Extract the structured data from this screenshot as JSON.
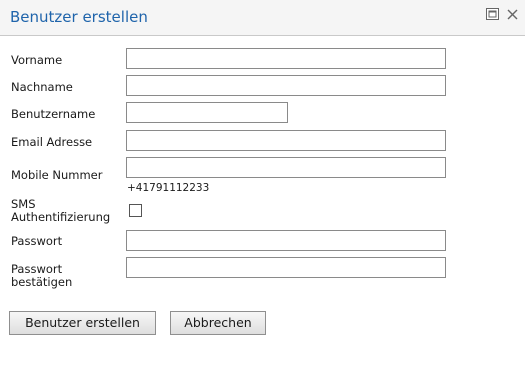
{
  "dialog": {
    "title": "Benutzer erstellen"
  },
  "window_controls": {
    "maximize_icon": "maximize-icon",
    "close_icon": "close-icon"
  },
  "form": {
    "firstname": {
      "label": "Vorname",
      "value": ""
    },
    "lastname": {
      "label": "Nachname",
      "value": ""
    },
    "username": {
      "label": "Benutzername",
      "value": ""
    },
    "email": {
      "label": "Email Adresse",
      "value": ""
    },
    "mobile": {
      "label": "Mobile Nummer",
      "value": "",
      "hint": "+41791112233"
    },
    "sms_auth": {
      "label_line1": "SMS",
      "label_line2": "Authentifizierung",
      "checked": false
    },
    "password": {
      "label": "Passwort",
      "value": ""
    },
    "password_confirm": {
      "label_line1": "Passwort",
      "label_line2": "bestätigen",
      "value": ""
    }
  },
  "buttons": {
    "create_label": "Benutzer erstellen",
    "cancel_label": "Abbrechen"
  },
  "colors": {
    "title_text": "#1f64ab",
    "titlebar_bg": "#f5f5f5",
    "field_border": "#8a8a8a"
  }
}
